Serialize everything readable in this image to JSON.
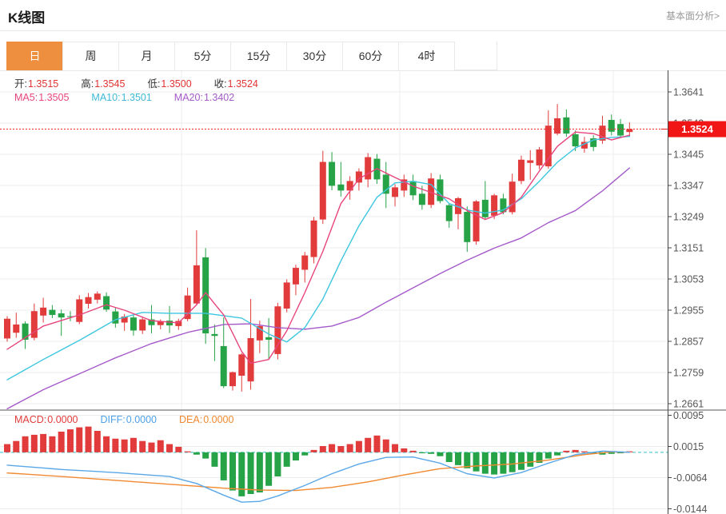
{
  "header": {
    "title": "K线图",
    "link_label": "基本面分析>"
  },
  "tabs": {
    "active_index": 0,
    "items": [
      "日",
      "周",
      "月",
      "5分",
      "15分",
      "30分",
      "60分",
      "4时"
    ]
  },
  "legend_ohlc": {
    "items": [
      {
        "label": "开:",
        "value": "1.3515"
      },
      {
        "label": "高:",
        "value": "1.3545"
      },
      {
        "label": "低:",
        "value": "1.3500"
      },
      {
        "label": "收:",
        "value": "1.3524"
      }
    ]
  },
  "legend_ma": {
    "items": [
      {
        "label": "MA5:",
        "value": "1.3505",
        "color": "#e8447e"
      },
      {
        "label": "MA10:",
        "value": "1.3501",
        "color": "#3fb9d8"
      },
      {
        "label": "MA20:",
        "value": "1.3402",
        "color": "#a55ac9"
      }
    ]
  },
  "legend_macd": {
    "items": [
      {
        "label": "MACD:",
        "value": "0.0000",
        "color": "#e23b3b"
      },
      {
        "label": "DIFF:",
        "value": "0.0000",
        "color": "#4da0e8"
      },
      {
        "label": "DEA:",
        "value": "0.0000",
        "color": "#f0892f"
      }
    ]
  },
  "price_tag": {
    "value": "1.3524"
  },
  "colors": {
    "up": "#e23b3b",
    "down": "#26a347",
    "ma5": "#e8447e",
    "ma10": "#3ec6e0",
    "ma20": "#a55ac9",
    "diff": "#5aa7e8",
    "dea": "#f0892f",
    "dotted_line": "#f42a2a",
    "zero_dash": "#2fc0cf",
    "grid": "#ececec",
    "vgrid": "#ededed",
    "axis_text": "#555",
    "axis_line": "#444",
    "separator": "#555",
    "tag_bg": "#f21515",
    "tag_text": "#ffffff",
    "tab_active_bg": "#ee8f3f"
  },
  "chart_data": {
    "type": "candlestick",
    "title": "K线图 (日)",
    "legend_position": "top-left",
    "grid": true,
    "main_pane": {
      "yticks": [
        "1.3641",
        "1.3543",
        "1.3445",
        "1.3347",
        "1.3249",
        "1.3151",
        "1.3053",
        "1.2955",
        "1.2857",
        "1.2759",
        "1.2661"
      ],
      "ylim": [
        1.2661,
        1.3641
      ],
      "last_price": 1.3524,
      "last_candle_ohlc": {
        "open": 1.3515,
        "high": 1.3545,
        "low": 1.35,
        "close": 1.3524
      },
      "candles": [
        [
          1.2866,
          1.2936,
          1.2856,
          1.2928
        ],
        [
          1.2884,
          1.2947,
          1.2868,
          1.291
        ],
        [
          1.2913,
          1.292,
          1.2833,
          1.2862
        ],
        [
          1.2868,
          1.2976,
          1.286,
          1.2952
        ],
        [
          1.2938,
          1.2994,
          1.2916,
          1.2963
        ],
        [
          1.2956,
          1.2971,
          1.293,
          1.294
        ],
        [
          1.2945,
          1.2957,
          1.2874,
          1.2932
        ],
        [
          1.2936,
          1.2952,
          1.292,
          1.2934
        ],
        [
          1.2918,
          1.3002,
          1.2911,
          1.2989
        ],
        [
          1.2975,
          1.3009,
          1.296,
          1.2996
        ],
        [
          1.2988,
          1.3014,
          1.2976,
          1.3007
        ],
        [
          1.2999,
          1.3011,
          1.295,
          1.2957
        ],
        [
          1.2951,
          1.2963,
          1.29,
          1.2913
        ],
        [
          1.2916,
          1.2943,
          1.289,
          1.2935
        ],
        [
          1.2932,
          1.2941,
          1.2875,
          1.2891
        ],
        [
          1.2891,
          1.2933,
          1.288,
          1.2926
        ],
        [
          1.2926,
          1.2971,
          1.2882,
          1.2908
        ],
        [
          1.2908,
          1.2926,
          1.2895,
          1.2919
        ],
        [
          1.2922,
          1.2968,
          1.2883,
          1.2907
        ],
        [
          1.2905,
          1.2928,
          1.2893,
          1.2921
        ],
        [
          1.2927,
          1.3026,
          1.292,
          1.3001
        ],
        [
          1.2976,
          1.3206,
          1.297,
          1.3096
        ],
        [
          1.3121,
          1.315,
          1.2849,
          1.2882
        ],
        [
          1.288,
          1.291,
          1.2795,
          1.2874
        ],
        [
          1.2842,
          1.2932,
          1.271,
          1.2716
        ],
        [
          1.2716,
          1.2762,
          1.2702,
          1.276
        ],
        [
          1.2749,
          1.282,
          1.2699,
          1.2816
        ],
        [
          1.2731,
          1.299,
          1.2705,
          1.2867
        ],
        [
          1.286,
          1.2922,
          1.282,
          1.2905
        ],
        [
          1.287,
          1.293,
          1.28,
          1.2862
        ],
        [
          1.2817,
          1.2978,
          1.28,
          1.2967
        ],
        [
          1.296,
          1.3052,
          1.2948,
          1.3042
        ],
        [
          1.3036,
          1.3098,
          1.3002,
          1.3088
        ],
        [
          1.3082,
          1.3138,
          1.3042,
          1.3127
        ],
        [
          1.3122,
          1.3248,
          1.3102,
          1.3237
        ],
        [
          1.324,
          1.3456,
          1.3226,
          1.3421
        ],
        [
          1.3421,
          1.3452,
          1.3332,
          1.3346
        ],
        [
          1.335,
          1.3421,
          1.3312,
          1.3331
        ],
        [
          1.3331,
          1.3376,
          1.3302,
          1.3361
        ],
        [
          1.3356,
          1.3401,
          1.3331,
          1.3391
        ],
        [
          1.3366,
          1.3449,
          1.3341,
          1.3436
        ],
        [
          1.3431,
          1.3446,
          1.3352,
          1.3366
        ],
        [
          1.3381,
          1.3421,
          1.3276,
          1.3321
        ],
        [
          1.3311,
          1.3351,
          1.3281,
          1.3341
        ],
        [
          1.3331,
          1.3381,
          1.3311,
          1.3366
        ],
        [
          1.3361,
          1.3381,
          1.3301,
          1.3316
        ],
        [
          1.3321,
          1.3346,
          1.3271,
          1.3286
        ],
        [
          1.3286,
          1.3386,
          1.3276,
          1.3369
        ],
        [
          1.3366,
          1.3381,
          1.3291,
          1.3298
        ],
        [
          1.3285,
          1.3291,
          1.3214,
          1.3235
        ],
        [
          1.3257,
          1.3311,
          1.3209,
          1.3307
        ],
        [
          1.3264,
          1.3281,
          1.3138,
          1.3169
        ],
        [
          1.3171,
          1.3301,
          1.3161,
          1.3297
        ],
        [
          1.3302,
          1.3361,
          1.3241,
          1.3247
        ],
        [
          1.3252,
          1.3321,
          1.3241,
          1.3316
        ],
        [
          1.3306,
          1.3321,
          1.3256,
          1.3263
        ],
        [
          1.3263,
          1.3384,
          1.3256,
          1.3359
        ],
        [
          1.3361,
          1.3441,
          1.3351,
          1.3428
        ],
        [
          1.3418,
          1.3458,
          1.3365,
          1.3426
        ],
        [
          1.341,
          1.3468,
          1.3398,
          1.346
        ],
        [
          1.3407,
          1.3583,
          1.34,
          1.3535
        ],
        [
          1.351,
          1.3603,
          1.3505,
          1.3558
        ],
        [
          1.3561,
          1.3586,
          1.35,
          1.351
        ],
        [
          1.3508,
          1.352,
          1.3455,
          1.347
        ],
        [
          1.3463,
          1.35,
          1.345,
          1.3484
        ],
        [
          1.3495,
          1.3505,
          1.3455,
          1.3468
        ],
        [
          1.3488,
          1.3566,
          1.3478,
          1.3535
        ],
        [
          1.3553,
          1.357,
          1.3504,
          1.3516
        ],
        [
          1.354,
          1.3556,
          1.3496,
          1.3504
        ],
        [
          1.3515,
          1.3545,
          1.35,
          1.3524
        ]
      ],
      "ma5_keys": [
        [
          0,
          1.2832
        ],
        [
          4,
          1.2905
        ],
        [
          8,
          1.294
        ],
        [
          11,
          1.2972
        ],
        [
          13,
          1.2955
        ],
        [
          16,
          1.2922
        ],
        [
          19,
          1.2915
        ],
        [
          21,
          1.2972
        ],
        [
          22,
          1.301
        ],
        [
          24,
          1.294
        ],
        [
          26,
          1.2825
        ],
        [
          27,
          1.2788
        ],
        [
          29,
          1.28
        ],
        [
          31,
          1.289
        ],
        [
          33,
          1.301
        ],
        [
          35,
          1.314
        ],
        [
          37,
          1.329
        ],
        [
          39,
          1.3368
        ],
        [
          41,
          1.34
        ],
        [
          43,
          1.3372
        ],
        [
          45,
          1.3345
        ],
        [
          47,
          1.3325
        ],
        [
          49,
          1.3305
        ],
        [
          51,
          1.3268
        ],
        [
          53,
          1.324
        ],
        [
          55,
          1.3262
        ],
        [
          57,
          1.331
        ],
        [
          59,
          1.3392
        ],
        [
          61,
          1.347
        ],
        [
          63,
          1.3515
        ],
        [
          65,
          1.351
        ],
        [
          67,
          1.349
        ],
        [
          69,
          1.3505
        ]
      ],
      "ma10_keys": [
        [
          0,
          1.2736
        ],
        [
          4,
          1.28
        ],
        [
          8,
          1.286
        ],
        [
          12,
          1.2925
        ],
        [
          15,
          1.2948
        ],
        [
          18,
          1.2945
        ],
        [
          22,
          1.2945
        ],
        [
          26,
          1.293
        ],
        [
          29,
          1.288
        ],
        [
          31,
          1.2855
        ],
        [
          33,
          1.29
        ],
        [
          35,
          1.299
        ],
        [
          37,
          1.311
        ],
        [
          39,
          1.322
        ],
        [
          41,
          1.331
        ],
        [
          43,
          1.3355
        ],
        [
          45,
          1.336
        ],
        [
          47,
          1.335
        ],
        [
          49,
          1.329
        ],
        [
          51,
          1.327
        ],
        [
          53,
          1.326
        ],
        [
          55,
          1.327
        ],
        [
          57,
          1.3305
        ],
        [
          59,
          1.336
        ],
        [
          61,
          1.342
        ],
        [
          63,
          1.3465
        ],
        [
          65,
          1.349
        ],
        [
          67,
          1.3498
        ],
        [
          69,
          1.3501
        ]
      ],
      "ma20_keys": [
        [
          0,
          1.2645
        ],
        [
          4,
          1.2705
        ],
        [
          8,
          1.2755
        ],
        [
          12,
          1.2805
        ],
        [
          16,
          1.285
        ],
        [
          20,
          1.2885
        ],
        [
          24,
          1.291
        ],
        [
          27,
          1.2912
        ],
        [
          30,
          1.29
        ],
        [
          33,
          1.2895
        ],
        [
          36,
          1.2905
        ],
        [
          39,
          1.2932
        ],
        [
          42,
          1.298
        ],
        [
          45,
          1.3025
        ],
        [
          48,
          1.307
        ],
        [
          51,
          1.3112
        ],
        [
          54,
          1.315
        ],
        [
          57,
          1.3182
        ],
        [
          60,
          1.323
        ],
        [
          63,
          1.3268
        ],
        [
          66,
          1.333
        ],
        [
          69,
          1.3402
        ]
      ]
    },
    "macd_pane": {
      "yticks": [
        "0.0095",
        "0.0015",
        "-0.0064",
        "-0.0144"
      ],
      "ylim": [
        -0.0144,
        0.0095
      ],
      "bars": [
        0.0021,
        0.0029,
        0.0041,
        0.0045,
        0.0047,
        0.0041,
        0.0053,
        0.0059,
        0.0064,
        0.0066,
        0.0055,
        0.0041,
        0.0035,
        0.0033,
        0.0037,
        0.0029,
        0.0025,
        0.0031,
        0.0021,
        0.0014,
        0.0002,
        -0.0006,
        -0.0016,
        -0.0037,
        -0.0072,
        -0.0098,
        -0.0113,
        -0.0107,
        -0.0103,
        -0.0086,
        -0.0062,
        -0.0037,
        -0.0021,
        -0.0008,
        0.0006,
        0.0016,
        0.0021,
        0.0016,
        0.0021,
        0.0029,
        0.0037,
        0.0043,
        0.0033,
        0.0021,
        0.001,
        0.0004,
        -0.0002,
        -0.0004,
        -0.001,
        -0.0025,
        -0.0033,
        -0.0041,
        -0.0049,
        -0.0055,
        -0.0057,
        -0.0055,
        -0.0051,
        -0.0045,
        -0.0037,
        -0.0027,
        -0.0016,
        -0.0008,
        0.0004,
        0.0006,
        0.0002,
        -0.0004,
        -0.0006,
        -0.0004,
        -0.0002,
        0.0
      ],
      "diff_keys": [
        [
          0,
          -0.0033
        ],
        [
          6,
          -0.0044
        ],
        [
          12,
          -0.0052
        ],
        [
          18,
          -0.0062
        ],
        [
          21,
          -0.008
        ],
        [
          24,
          -0.011
        ],
        [
          26,
          -0.0128
        ],
        [
          28,
          -0.0126
        ],
        [
          30,
          -0.0112
        ],
        [
          33,
          -0.0085
        ],
        [
          36,
          -0.0055
        ],
        [
          39,
          -0.003
        ],
        [
          42,
          -0.0013
        ],
        [
          45,
          -0.0012
        ],
        [
          48,
          -0.0028
        ],
        [
          51,
          -0.0055
        ],
        [
          54,
          -0.0066
        ],
        [
          57,
          -0.0052
        ],
        [
          60,
          -0.0028
        ],
        [
          63,
          -0.0006
        ],
        [
          66,
          0.0003
        ],
        [
          69,
          0.0
        ]
      ],
      "dea_keys": [
        [
          0,
          -0.0053
        ],
        [
          6,
          -0.0062
        ],
        [
          12,
          -0.0072
        ],
        [
          18,
          -0.0082
        ],
        [
          24,
          -0.0092
        ],
        [
          28,
          -0.0097
        ],
        [
          32,
          -0.0098
        ],
        [
          36,
          -0.009
        ],
        [
          40,
          -0.0076
        ],
        [
          44,
          -0.0058
        ],
        [
          48,
          -0.0042
        ],
        [
          52,
          -0.0035
        ],
        [
          56,
          -0.003
        ],
        [
          60,
          -0.002
        ],
        [
          64,
          -0.0006
        ],
        [
          67,
          0.0001
        ],
        [
          69,
          0.0
        ]
      ]
    }
  }
}
